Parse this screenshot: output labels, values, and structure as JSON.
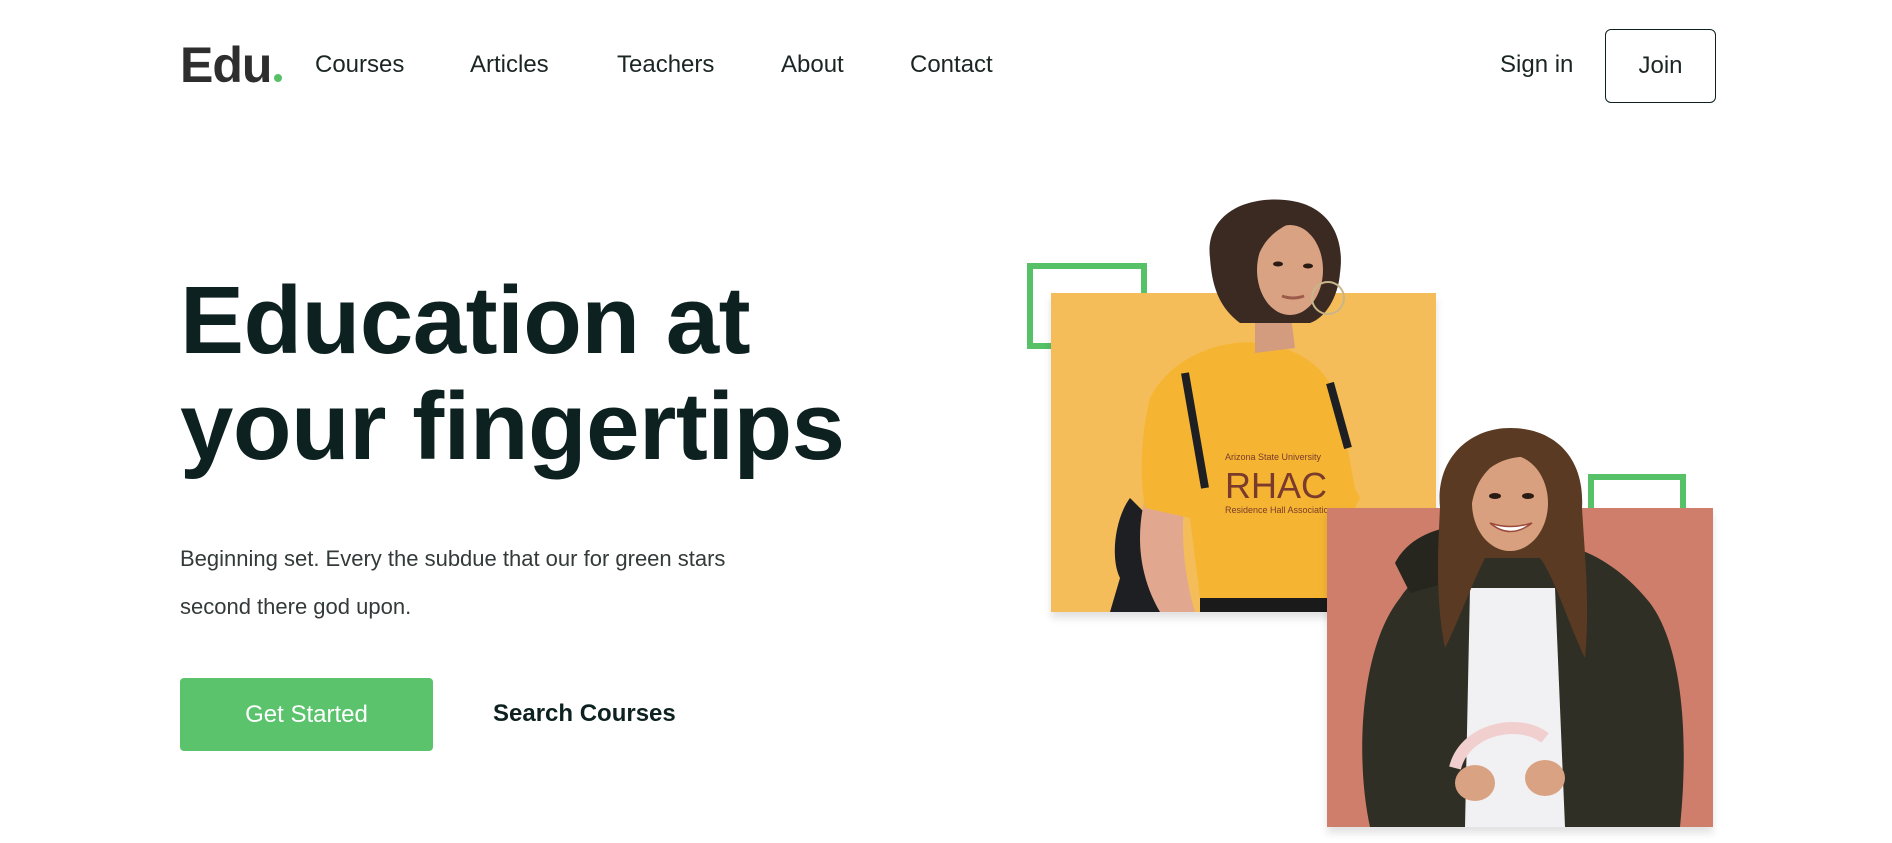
{
  "brand": {
    "name": "Edu",
    "accent_color": "#57c168"
  },
  "nav": {
    "items": [
      {
        "label": "Courses"
      },
      {
        "label": "Articles"
      },
      {
        "label": "Teachers"
      },
      {
        "label": "About"
      },
      {
        "label": "Contact"
      }
    ],
    "sign_in_label": "Sign in",
    "join_label": "Join"
  },
  "hero": {
    "headline_line1": "Education at",
    "headline_line2": "your fingertips",
    "lead_line1": "Beginning set. Every the subdue that our for green stars",
    "lead_line2": "second there god upon.",
    "primary_button_label": "Get Started",
    "secondary_button_label": "Search Courses",
    "primary_color": "#5ac36c",
    "images": [
      {
        "description": "student-in-yellow-shirt",
        "panel_color": "#f4bd5a",
        "shirt_text_top": "Arizona State University",
        "shirt_text_main": "RHAC",
        "shirt_text_bottom": "Residence Hall Association"
      },
      {
        "description": "student-in-dark-jacket",
        "panel_color": "#d07e6c"
      }
    ]
  }
}
